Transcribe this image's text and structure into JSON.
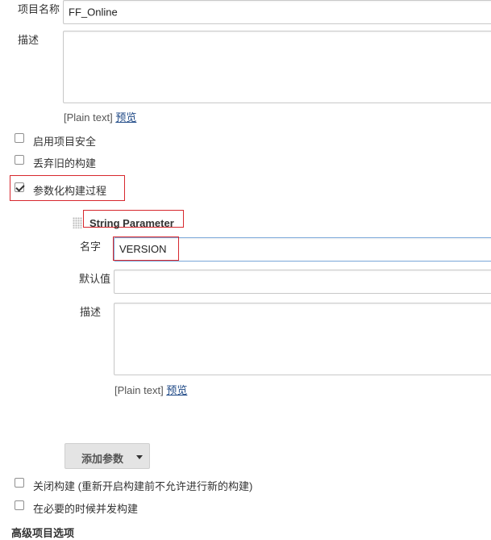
{
  "project": {
    "name_label": "项目名称",
    "name_value": "FF_Online",
    "description_label": "描述",
    "plain_text": "[Plain text]",
    "preview_link": "预览"
  },
  "options": [
    {
      "label": "启用项目安全",
      "checked": false
    },
    {
      "label": "丢弃旧的构建",
      "checked": false
    },
    {
      "label": "参数化构建过程",
      "checked": true
    }
  ],
  "parameter": {
    "type_title": "String Parameter",
    "name_label": "名字",
    "name_value": "VERSION",
    "default_label": "默认值",
    "default_value": "",
    "description_label": "描述",
    "plain_text": "[Plain text]",
    "preview_link": "预览"
  },
  "add_param_button": "添加参数",
  "bottom_options": [
    {
      "label": "关闭构建 (重新开启构建前不允许进行新的构建)",
      "checked": false
    },
    {
      "label": "在必要的时候并发构建",
      "checked": false
    }
  ],
  "advanced_section_title": "高级项目选项",
  "colors": {
    "highlight_border": "#d7282e",
    "link": "#204a87",
    "button_bg": "#e4e4e4"
  }
}
